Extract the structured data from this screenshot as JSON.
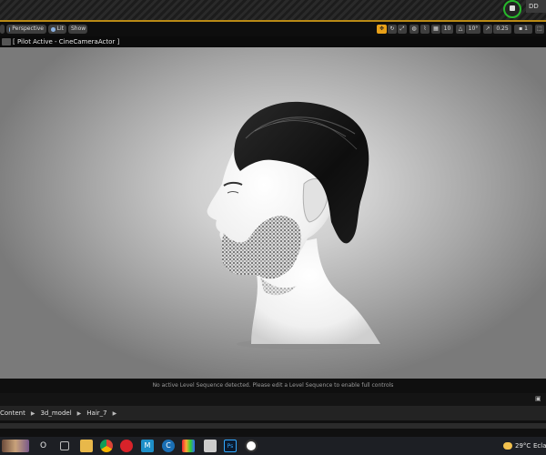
{
  "toolbar": {
    "perspective_label": "Perspective",
    "lit_label": "Lit",
    "show_label": "Show",
    "grid_value": "10",
    "rotation_value": "10°",
    "scale_value": "0.25",
    "camera_speed": "1"
  },
  "pilot": {
    "text": "[ Pilot Active - CineCameraActor ]"
  },
  "viewport": {
    "message": "No active Level Sequence detected. Please edit a Level Sequence to enable full controls"
  },
  "breadcrumb": {
    "items": [
      "Content",
      "3d_model",
      "Hair_7"
    ]
  },
  "topbar": {
    "dropdown_label": "DD"
  },
  "taskbar": {
    "search_label": "O",
    "temperature": "29°C",
    "weather_text": "Eclair"
  },
  "colors": {
    "accent": "#e8a018",
    "gold_line": "#b98a16",
    "status_green": "#27b82b"
  }
}
